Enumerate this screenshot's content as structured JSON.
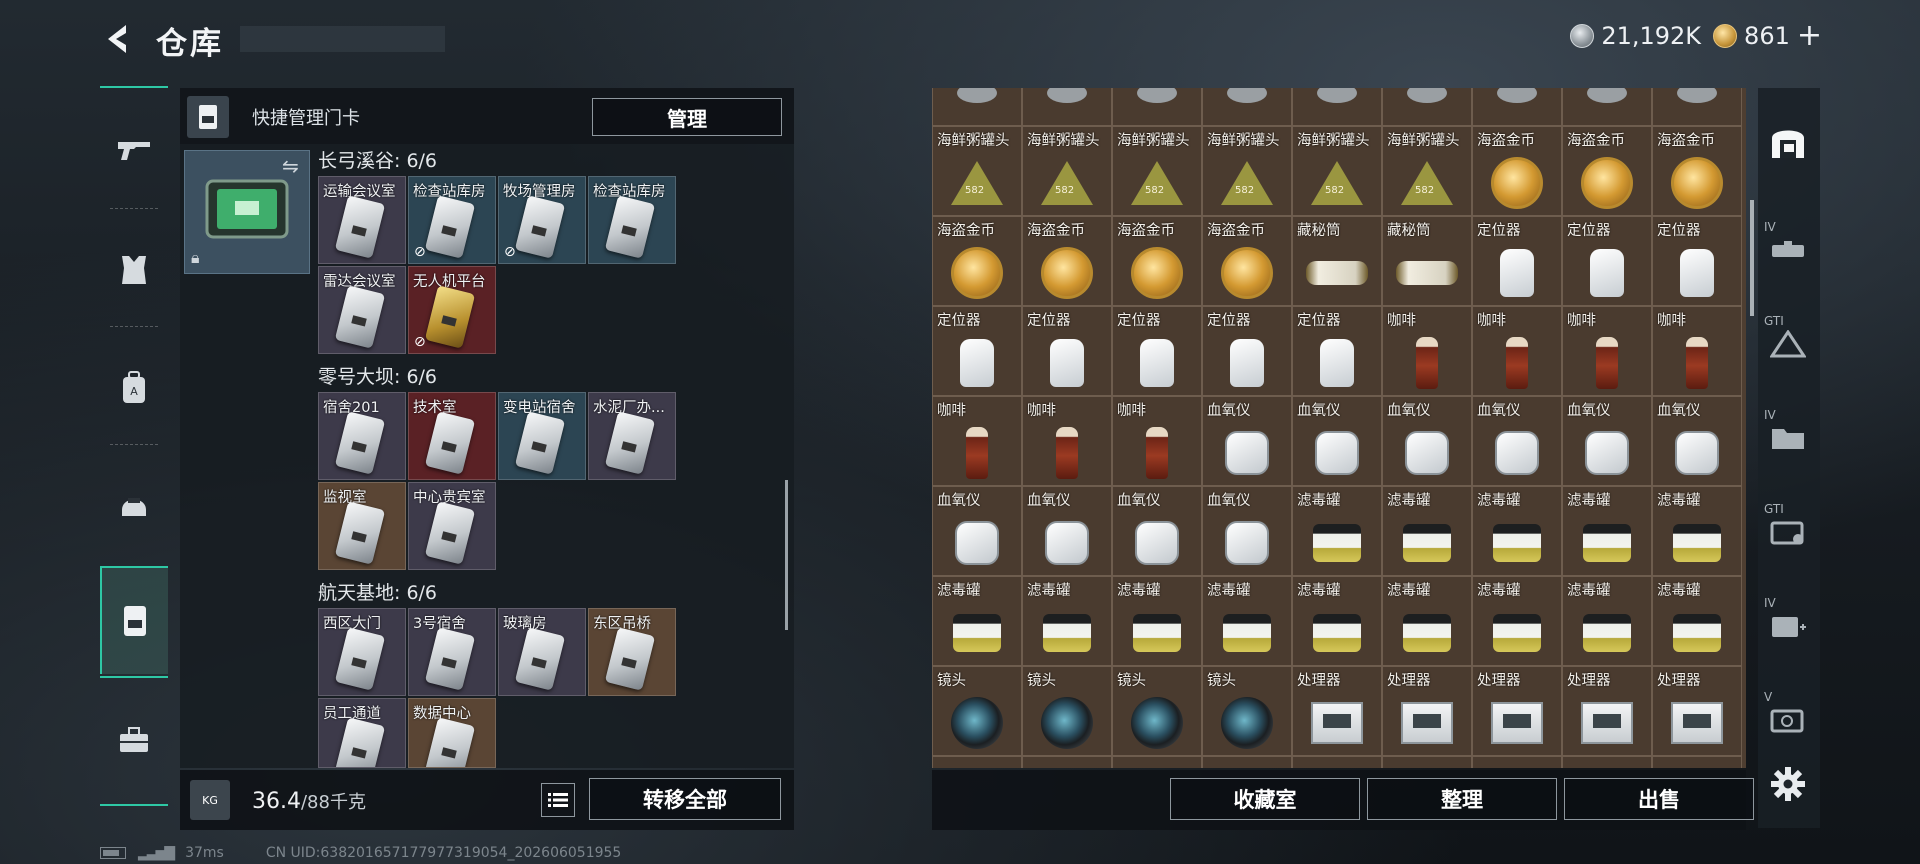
{
  "header": {
    "title": "仓库",
    "currency": [
      {
        "icon": "silver-coin-icon",
        "value": "21,192K"
      },
      {
        "icon": "gold-coin-icon",
        "value": "861"
      }
    ],
    "currency_add": "+"
  },
  "left_nav": [
    {
      "name": "weapons-icon",
      "active": false
    },
    {
      "name": "armor-icon",
      "active": false
    },
    {
      "name": "backpack-icon",
      "active": false
    },
    {
      "name": "helmet-icon",
      "active": false
    },
    {
      "name": "keycard-icon",
      "active": true
    },
    {
      "name": "toolbox-icon",
      "active": false
    }
  ],
  "keycard_panel": {
    "header_label": "快捷管理门卡",
    "manage_button": "管理",
    "regions": [
      {
        "title": "长弓溪谷: 6/6",
        "cards": [
          {
            "label": "运输会议室",
            "color": "purple",
            "disabled": false
          },
          {
            "label": "检查站库房",
            "color": "blue",
            "disabled": true
          },
          {
            "label": "牧场管理房",
            "color": "blue",
            "disabled": true
          },
          {
            "label": "检查站库房",
            "color": "blue",
            "disabled": false
          },
          {
            "label": "雷达会议室",
            "color": "purple",
            "disabled": false
          },
          {
            "label": "无人机平台",
            "color": "red",
            "disabled": true
          }
        ]
      },
      {
        "title": "零号大坝: 6/6",
        "cards": [
          {
            "label": "宿舍201",
            "color": "purple",
            "disabled": false
          },
          {
            "label": "技术室",
            "color": "red",
            "disabled": false
          },
          {
            "label": "变电站宿舍",
            "color": "blue",
            "disabled": false
          },
          {
            "label": "水泥厂办...",
            "color": "purple",
            "disabled": false
          },
          {
            "label": "监视室",
            "color": "brown",
            "disabled": false
          },
          {
            "label": "中心贵宾室",
            "color": "purple",
            "disabled": false
          }
        ]
      },
      {
        "title": "航天基地: 6/6",
        "cards": [
          {
            "label": "西区大门",
            "color": "purple",
            "disabled": false
          },
          {
            "label": "3号宿舍",
            "color": "purple",
            "disabled": false
          },
          {
            "label": "玻璃房",
            "color": "purple",
            "disabled": false
          },
          {
            "label": "东区吊桥",
            "color": "brown",
            "disabled": false
          },
          {
            "label": "员工通道",
            "color": "purple",
            "disabled": false
          },
          {
            "label": "数据中心",
            "color": "brown",
            "disabled": false
          }
        ]
      }
    ],
    "weight": {
      "current": "36.4",
      "max": "/88千克"
    },
    "transfer_button": "转移全部",
    "list_icon": "list-icon"
  },
  "status_bar": {
    "ping": "37ms",
    "uid": "CN UID:638201657177977319054_202606051955"
  },
  "storage": {
    "rows": [
      [
        "",
        "",
        "",
        "",
        "",
        "",
        "",
        "",
        ""
      ],
      [
        "海鲜粥罐头",
        "海鲜粥罐头",
        "海鲜粥罐头",
        "海鲜粥罐头",
        "海鲜粥罐头",
        "海鲜粥罐头",
        "海盗金币",
        "海盗金币",
        "海盗金币"
      ],
      [
        "海盗金币",
        "海盗金币",
        "海盗金币",
        "海盗金币",
        "藏秘筒",
        "藏秘筒",
        "定位器",
        "定位器",
        "定位器"
      ],
      [
        "定位器",
        "定位器",
        "定位器",
        "定位器",
        "定位器",
        "咖啡",
        "咖啡",
        "咖啡",
        "咖啡"
      ],
      [
        "咖啡",
        "咖啡",
        "咖啡",
        "血氧仪",
        "血氧仪",
        "血氧仪",
        "血氧仪",
        "血氧仪",
        "血氧仪"
      ],
      [
        "血氧仪",
        "血氧仪",
        "血氧仪",
        "血氧仪",
        "滤毒罐",
        "滤毒罐",
        "滤毒罐",
        "滤毒罐",
        "滤毒罐"
      ],
      [
        "滤毒罐",
        "滤毒罐",
        "滤毒罐",
        "滤毒罐",
        "滤毒罐",
        "滤毒罐",
        "滤毒罐",
        "滤毒罐",
        "滤毒罐"
      ],
      [
        "镜头",
        "镜头",
        "镜头",
        "镜头",
        "处理器",
        "处理器",
        "处理器",
        "处理器",
        "处理器"
      ],
      [
        "",
        "",
        "",
        "",
        "",
        "",
        "",
        "",
        ""
      ]
    ],
    "buttons": [
      "收藏室",
      "整理",
      "出售"
    ]
  },
  "right_rail": [
    {
      "icon": "storage-home-icon",
      "tag": ""
    },
    {
      "icon": "gun-case-icon",
      "tag": "IV"
    },
    {
      "icon": "armor-case-icon",
      "tag": "GTI"
    },
    {
      "icon": "folder-case-icon",
      "tag": "IV"
    },
    {
      "icon": "gti-case-icon",
      "tag": "GTI"
    },
    {
      "icon": "medical-case-icon",
      "tag": "IV"
    },
    {
      "icon": "safe-case-icon",
      "tag": "V"
    },
    {
      "icon": "settings-gear-icon",
      "tag": ""
    }
  ]
}
